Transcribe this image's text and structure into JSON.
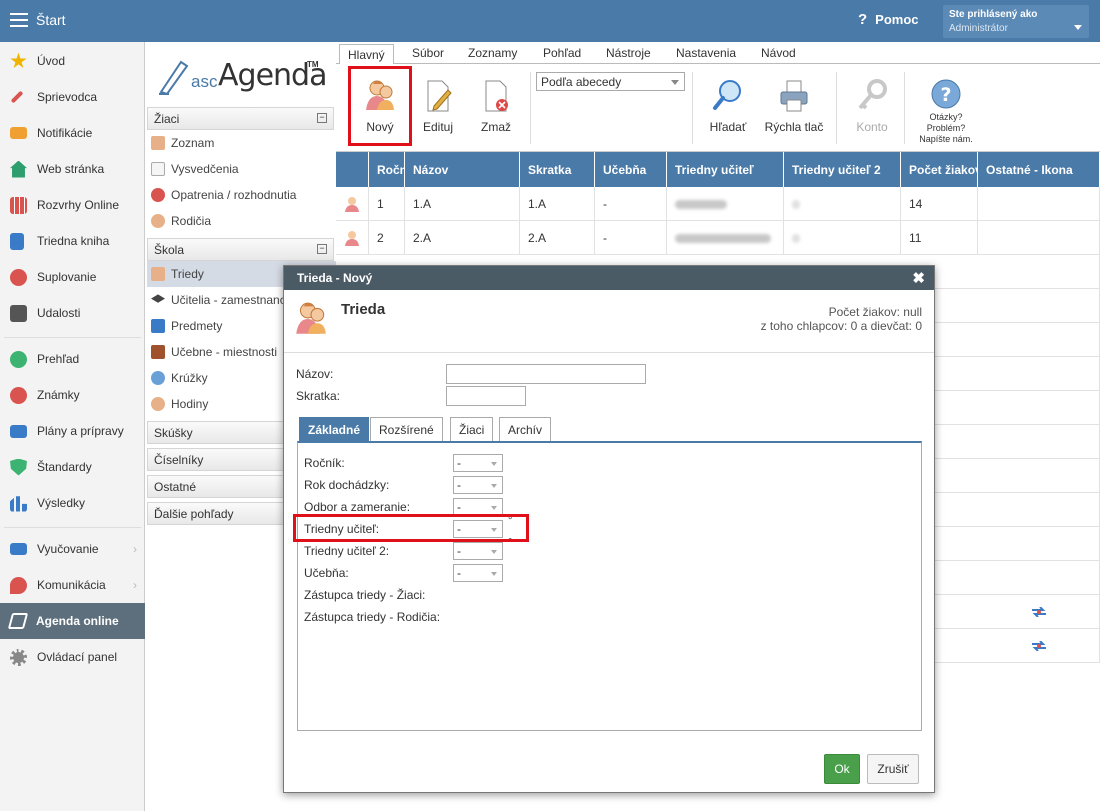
{
  "topbar": {
    "start_label": "Štart",
    "help_label": "Pomoc",
    "user_caption": "Ste prihlásený ako",
    "user_role": "Administrátor"
  },
  "leftnav": [
    {
      "label": "Úvod",
      "icon": "star-icon",
      "color": "#f0b400"
    },
    {
      "label": "Sprievodca",
      "icon": "wand-icon",
      "color": "#d9534f"
    },
    {
      "label": "Notifikácie",
      "icon": "envelope-icon",
      "color": "#f0a030"
    },
    {
      "label": "Web stránka",
      "icon": "home-icon",
      "color": "#2e9e6e"
    },
    {
      "label": "Rozvrhy Online",
      "icon": "calendar-grid-icon",
      "color": "#d9534f"
    },
    {
      "label": "Triedna kniha",
      "icon": "book-icon",
      "color": "#3a7bc8"
    },
    {
      "label": "Suplovanie",
      "icon": "person-swap-icon",
      "color": "#d9534f"
    },
    {
      "label": "Udalosti",
      "icon": "calendar-icon",
      "color": "#555555"
    },
    {
      "label": "Prehľad",
      "icon": "check-circle-icon",
      "color": "#3cb371"
    },
    {
      "label": "Známky",
      "icon": "grade-icon",
      "color": "#d9534f"
    },
    {
      "label": "Plány a prípravy",
      "icon": "briefcase-icon",
      "color": "#3a7bc8"
    },
    {
      "label": "Štandardy",
      "icon": "shield-check-icon",
      "color": "#3cb371"
    },
    {
      "label": "Výsledky",
      "icon": "bar-chart-icon",
      "color": "#3a7bc8"
    },
    {
      "label": "Vyučovanie",
      "icon": "open-book-icon",
      "color": "#3a7bc8"
    },
    {
      "label": "Komunikácia",
      "icon": "chat-icon",
      "color": "#d9534f"
    },
    {
      "label": "Agenda online",
      "icon": "pen-icon",
      "color": "#ffffff"
    },
    {
      "label": "Ovládací panel",
      "icon": "gear-icon",
      "color": "#888888"
    }
  ],
  "midpanel": {
    "logo_asc": "asc",
    "logo_agenda": "Agenda",
    "logo_tm": "TM",
    "section_ziaci": "Žiaci",
    "ziaci_items": [
      "Zoznam",
      "Vysvedčenia",
      "Opatrenia / rozhodnutia",
      "Rodičia"
    ],
    "section_skola": "Škola",
    "skola_items": [
      "Triedy",
      "Učitelia - zamestnanci",
      "Predmety",
      "Učebne - miestnosti",
      "Krúžky",
      "Hodiny"
    ],
    "more_sections": [
      "Skúšky",
      "Číselníky",
      "Ostatné",
      "Ďalšie pohľady"
    ]
  },
  "menutabs": [
    "Hlavný",
    "Súbor",
    "Zoznamy",
    "Pohľad",
    "Nástroje",
    "Nastavenia",
    "Návod"
  ],
  "ribbon": {
    "new": "Nový",
    "edit": "Edituj",
    "delete": "Zmaž",
    "sort_value": "Podľa abecedy",
    "find": "Hľadať",
    "quick_print": "Rýchla tlač",
    "account": "Konto",
    "help_lines": [
      "Otázky?",
      "Problém?",
      "Napíšte nám."
    ]
  },
  "grid": {
    "headers": [
      "Ročník",
      "Názov",
      "Skratka",
      "Učebňa",
      "Triedny učiteľ",
      "Triedny učiteľ 2",
      "Počet žiakov",
      "Ostatné - Ikona"
    ],
    "rows": [
      {
        "rocnik": "1",
        "nazov": "1.A",
        "skratka": "1.A",
        "ucebna": "-",
        "ziakov": "14"
      },
      {
        "rocnik": "2",
        "nazov": "2.A",
        "skratka": "2.A",
        "ucebna": "-",
        "ziakov": "11"
      }
    ]
  },
  "dialog": {
    "title": "Trieda - Nový",
    "heading": "Trieda",
    "count_line": "Počet žiakov: null",
    "gender_line": "z toho chlapcov: 0 a dievčat: 0",
    "name_label": "Názov:",
    "short_label": "Skratka:",
    "name_value": "",
    "short_value": "",
    "tabs": [
      "Základné",
      "Rozšírené",
      "Žiaci",
      "Archív"
    ],
    "fields": [
      {
        "label": "Ročník:",
        "value": "-"
      },
      {
        "label": "Rok dochádzky:",
        "value": "-"
      },
      {
        "label": "Odbor a zameranie:",
        "value": "-"
      },
      {
        "label": "Triedny učiteľ:",
        "value": "-"
      },
      {
        "label": "Triedny učiteľ 2:",
        "value": "-"
      },
      {
        "label": "Učebňa:",
        "value": "-"
      }
    ],
    "deg_mark": "°",
    "deputy_students": "Zástupca triedy - Žiaci:",
    "deputy_parents": "Zástupca triedy - Rodičia:",
    "ok": "Ok",
    "cancel": "Zrušiť"
  }
}
